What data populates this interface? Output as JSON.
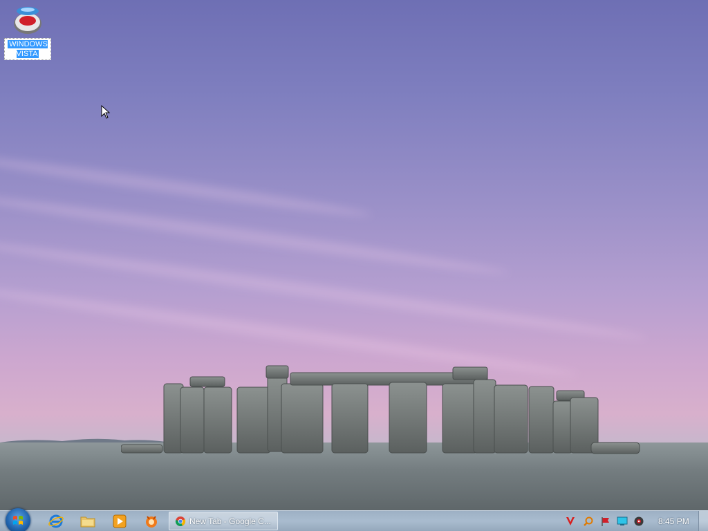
{
  "desktop": {
    "icons": [
      {
        "label": "WINDOWS VISTA",
        "icon": "vista-orb-icon"
      }
    ]
  },
  "taskbar": {
    "start_icon": "windows-logo-icon",
    "pinned": [
      {
        "name": "internet-explorer-icon"
      },
      {
        "name": "file-explorer-icon"
      },
      {
        "name": "media-player-icon"
      },
      {
        "name": "app-icon"
      }
    ],
    "windows": [
      {
        "label": "New Tab - Google C...",
        "icon": "chrome-icon"
      }
    ],
    "tray_icons": [
      "antivirus-v-icon",
      "search-tray-icon",
      "flag-icon",
      "display-icon",
      "webcam-icon"
    ],
    "clock": "8:45 PM"
  },
  "colors": {
    "sky_top": "#6e6fb4",
    "sky_bottom": "#d8b0cc",
    "taskbar": "#a9bccf",
    "selection": "#3399ff"
  }
}
